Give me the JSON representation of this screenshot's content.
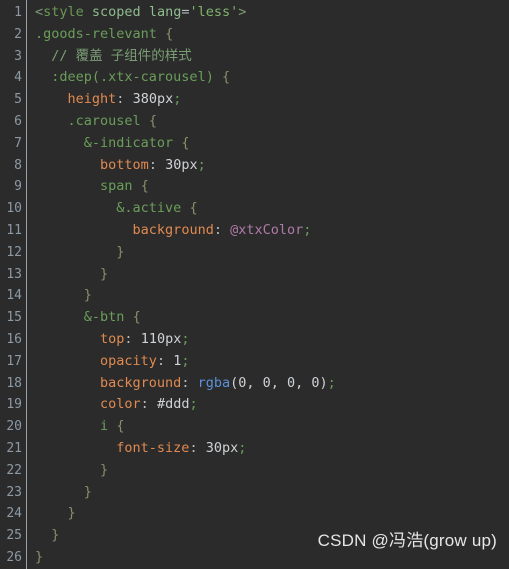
{
  "editor": {
    "background_color": "#2b2b2b",
    "gutter_separator_color": "#9aa0a6",
    "language": "less",
    "total_lines": 26
  },
  "gutter": {
    "line_numbers": [
      "1",
      "2",
      "3",
      "4",
      "5",
      "6",
      "7",
      "8",
      "9",
      "10",
      "11",
      "12",
      "13",
      "14",
      "15",
      "16",
      "17",
      "18",
      "19",
      "20",
      "21",
      "22",
      "23",
      "24",
      "25",
      "26"
    ]
  },
  "code": {
    "lines": [
      {
        "number": "1",
        "indent": "",
        "tokens": [
          {
            "t": "<",
            "c": "punct"
          },
          {
            "t": "style",
            "c": "tag"
          },
          {
            "t": " ",
            "c": "value"
          },
          {
            "t": "scoped",
            "c": "attr"
          },
          {
            "t": " ",
            "c": "value"
          },
          {
            "t": "lang",
            "c": "attr"
          },
          {
            "t": "=",
            "c": "colon"
          },
          {
            "t": "'less'",
            "c": "string"
          },
          {
            "t": ">",
            "c": "punct"
          }
        ]
      },
      {
        "number": "2",
        "indent": "",
        "tokens": [
          {
            "t": ".goods-relevant",
            "c": "selector"
          },
          {
            "t": " ",
            "c": "value"
          },
          {
            "t": "{",
            "c": "brace"
          }
        ]
      },
      {
        "number": "3",
        "indent": "  ",
        "tokens": [
          {
            "t": "// 覆盖 子组件的样式",
            "c": "comment"
          }
        ]
      },
      {
        "number": "4",
        "indent": "  ",
        "tokens": [
          {
            "t": ":deep(.xtx-carousel)",
            "c": "selector"
          },
          {
            "t": " ",
            "c": "value"
          },
          {
            "t": "{",
            "c": "brace"
          }
        ]
      },
      {
        "number": "5",
        "indent": "    ",
        "tokens": [
          {
            "t": "height",
            "c": "prop"
          },
          {
            "t": ":",
            "c": "colon"
          },
          {
            "t": " ",
            "c": "value"
          },
          {
            "t": "380px",
            "c": "value"
          },
          {
            "t": ";",
            "c": "semi"
          }
        ]
      },
      {
        "number": "6",
        "indent": "    ",
        "tokens": [
          {
            "t": ".carousel",
            "c": "selector"
          },
          {
            "t": " ",
            "c": "value"
          },
          {
            "t": "{",
            "c": "brace"
          }
        ]
      },
      {
        "number": "7",
        "indent": "      ",
        "tokens": [
          {
            "t": "&-indicator",
            "c": "selector"
          },
          {
            "t": " ",
            "c": "value"
          },
          {
            "t": "{",
            "c": "brace"
          }
        ]
      },
      {
        "number": "8",
        "indent": "        ",
        "tokens": [
          {
            "t": "bottom",
            "c": "prop"
          },
          {
            "t": ":",
            "c": "colon"
          },
          {
            "t": " ",
            "c": "value"
          },
          {
            "t": "30px",
            "c": "value"
          },
          {
            "t": ";",
            "c": "semi"
          }
        ]
      },
      {
        "number": "9",
        "indent": "        ",
        "tokens": [
          {
            "t": "span",
            "c": "selector"
          },
          {
            "t": " ",
            "c": "value"
          },
          {
            "t": "{",
            "c": "brace"
          }
        ]
      },
      {
        "number": "10",
        "indent": "          ",
        "tokens": [
          {
            "t": "&.active",
            "c": "selector"
          },
          {
            "t": " ",
            "c": "value"
          },
          {
            "t": "{",
            "c": "brace"
          }
        ]
      },
      {
        "number": "11",
        "indent": "            ",
        "tokens": [
          {
            "t": "background",
            "c": "prop"
          },
          {
            "t": ":",
            "c": "colon"
          },
          {
            "t": " ",
            "c": "value"
          },
          {
            "t": "@xtxColor",
            "c": "var"
          },
          {
            "t": ";",
            "c": "semi"
          }
        ]
      },
      {
        "number": "12",
        "indent": "          ",
        "tokens": [
          {
            "t": "}",
            "c": "brace"
          }
        ]
      },
      {
        "number": "13",
        "indent": "        ",
        "tokens": [
          {
            "t": "}",
            "c": "brace"
          }
        ]
      },
      {
        "number": "14",
        "indent": "      ",
        "tokens": [
          {
            "t": "}",
            "c": "brace"
          }
        ]
      },
      {
        "number": "15",
        "indent": "      ",
        "tokens": [
          {
            "t": "&-btn",
            "c": "selector"
          },
          {
            "t": " ",
            "c": "value"
          },
          {
            "t": "{",
            "c": "brace"
          }
        ]
      },
      {
        "number": "16",
        "indent": "        ",
        "tokens": [
          {
            "t": "top",
            "c": "prop"
          },
          {
            "t": ":",
            "c": "colon"
          },
          {
            "t": " ",
            "c": "value"
          },
          {
            "t": "110px",
            "c": "value"
          },
          {
            "t": ";",
            "c": "semi"
          }
        ]
      },
      {
        "number": "17",
        "indent": "        ",
        "tokens": [
          {
            "t": "opacity",
            "c": "prop"
          },
          {
            "t": ":",
            "c": "colon"
          },
          {
            "t": " ",
            "c": "value"
          },
          {
            "t": "1",
            "c": "value"
          },
          {
            "t": ";",
            "c": "semi"
          }
        ]
      },
      {
        "number": "18",
        "indent": "        ",
        "tokens": [
          {
            "t": "background",
            "c": "prop"
          },
          {
            "t": ":",
            "c": "colon"
          },
          {
            "t": " ",
            "c": "value"
          },
          {
            "t": "rgba",
            "c": "func"
          },
          {
            "t": "(0, 0, 0, 0)",
            "c": "value"
          },
          {
            "t": ";",
            "c": "semi"
          }
        ]
      },
      {
        "number": "19",
        "indent": "        ",
        "tokens": [
          {
            "t": "color",
            "c": "prop"
          },
          {
            "t": ":",
            "c": "colon"
          },
          {
            "t": " ",
            "c": "value"
          },
          {
            "t": "#ddd",
            "c": "value"
          },
          {
            "t": ";",
            "c": "semi"
          }
        ]
      },
      {
        "number": "20",
        "indent": "        ",
        "tokens": [
          {
            "t": "i",
            "c": "selector"
          },
          {
            "t": " ",
            "c": "value"
          },
          {
            "t": "{",
            "c": "brace"
          }
        ]
      },
      {
        "number": "21",
        "indent": "          ",
        "tokens": [
          {
            "t": "font-size",
            "c": "prop"
          },
          {
            "t": ":",
            "c": "colon"
          },
          {
            "t": " ",
            "c": "value"
          },
          {
            "t": "30px",
            "c": "value"
          },
          {
            "t": ";",
            "c": "semi"
          }
        ]
      },
      {
        "number": "22",
        "indent": "        ",
        "tokens": [
          {
            "t": "}",
            "c": "brace"
          }
        ]
      },
      {
        "number": "23",
        "indent": "      ",
        "tokens": [
          {
            "t": "}",
            "c": "brace"
          }
        ]
      },
      {
        "number": "24",
        "indent": "    ",
        "tokens": [
          {
            "t": "}",
            "c": "brace"
          }
        ]
      },
      {
        "number": "25",
        "indent": "  ",
        "tokens": [
          {
            "t": "}",
            "c": "brace"
          }
        ]
      },
      {
        "number": "26",
        "indent": "",
        "tokens": [
          {
            "t": "}",
            "c": "brace"
          }
        ]
      }
    ]
  },
  "watermark": {
    "text": "CSDN @冯浩(grow up)",
    "color": "#e6e6e6"
  },
  "colors": {
    "tag": "#6a9955",
    "attr": "#8fbc8f",
    "string": "#7fb36b",
    "comment": "#7a9e74",
    "selector": "#6a9e5a",
    "brace": "#8a8f6a",
    "property": "#e08a50",
    "value": "#cfd2d6",
    "semicolon": "#6a9e5a",
    "variable": "#b07aa8",
    "function": "#5b91d6",
    "line_number": "#8c9aa6",
    "background": "#2b2b2b"
  }
}
